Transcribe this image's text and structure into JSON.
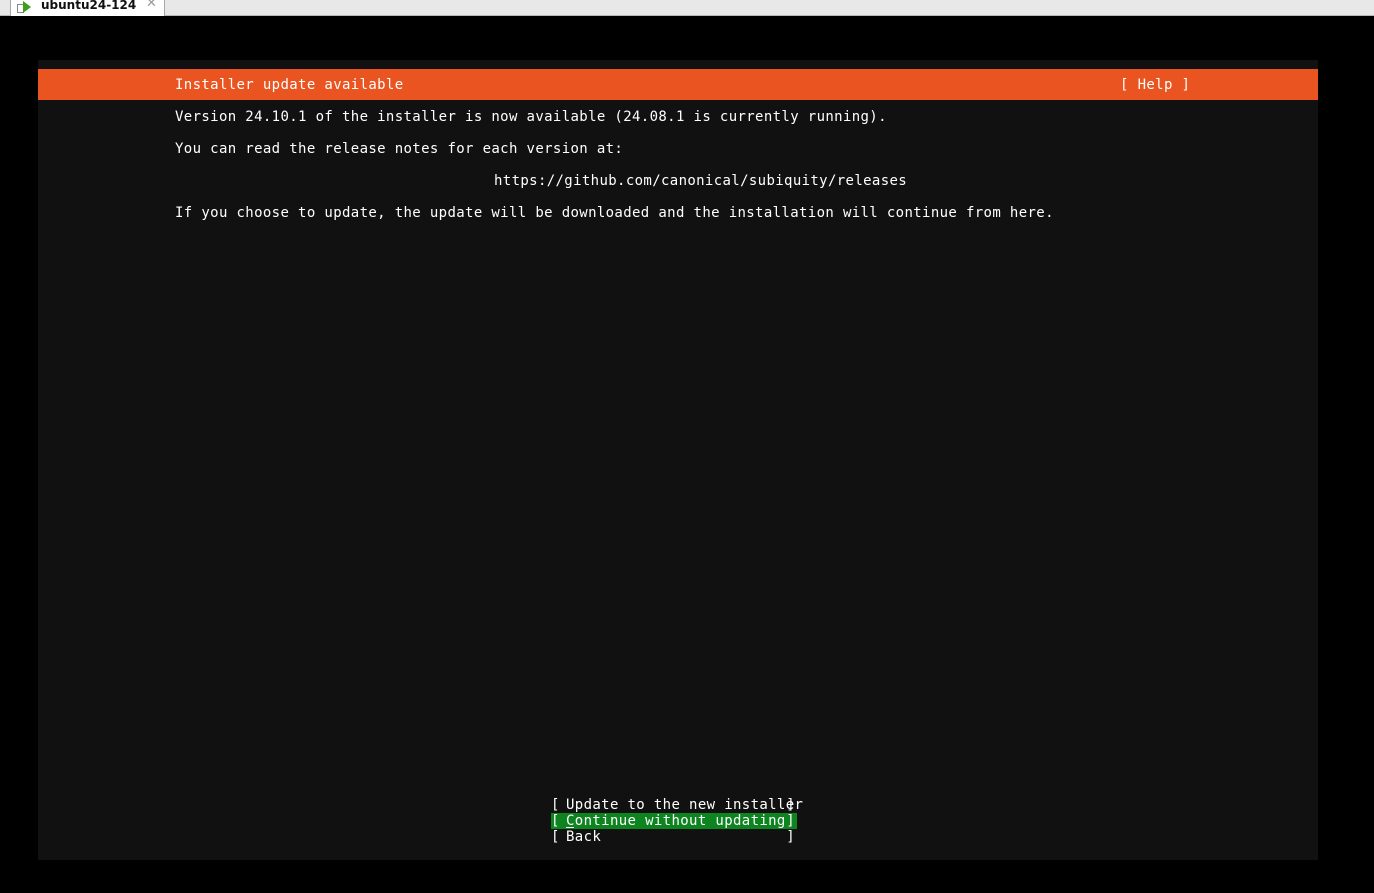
{
  "window": {
    "tab_title": "ubuntu24-124",
    "tab_close": "✕"
  },
  "installer": {
    "header": {
      "title": "Installer update available",
      "help": "[ Help ]"
    },
    "body": {
      "line1": "Version 24.10.1 of the installer is now available (24.08.1 is currently running).",
      "line2": "You can read the release notes for each version at:",
      "url": "https://github.com/canonical/subiquity/releases",
      "line4": "If you choose to update, the update will be downloaded and the installation will continue from here."
    },
    "buttons": [
      {
        "label": "Update to the new installer",
        "bracket_left": "[",
        "bracket_right": "]"
      },
      {
        "label": "Continue without updating",
        "bracket_left": "[",
        "bracket_right": "]",
        "focused": true
      },
      {
        "label": "Back",
        "bracket_left": "[",
        "bracket_right": "]"
      }
    ],
    "colors": {
      "header_bg": "#e95420",
      "focus_bg": "#0e8420",
      "screen_bg": "#111111"
    }
  }
}
